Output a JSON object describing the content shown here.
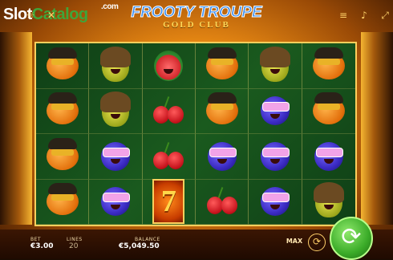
{
  "watermark": {
    "part1": "Slot",
    "part2": "Catalog",
    "suffix": ".com"
  },
  "game_title": {
    "line1": "FROOTY TROUPE",
    "line2": "GOLD CLUB"
  },
  "top_icons": {
    "left": [
      "bulb-icon",
      "close-icon"
    ],
    "right": [
      "menu-icon",
      "sound-icon",
      "fullscreen-icon"
    ]
  },
  "reels": [
    [
      "orange",
      "pear",
      "watermelon",
      "orange",
      "pear",
      "orange"
    ],
    [
      "orange",
      "pear",
      "cherry",
      "orange",
      "plum",
      "orange"
    ],
    [
      "orange",
      "plum",
      "cherry",
      "plum",
      "plum",
      "plum"
    ],
    [
      "orange",
      "plum",
      "seven",
      "cherry",
      "plum",
      "pear"
    ]
  ],
  "seven_glyph": "7",
  "footer": {
    "bet_label": "BET",
    "bet_value": "€3.00",
    "lines_label": "LINES",
    "lines_value": "20",
    "balance_label": "BALANCE",
    "balance_value": "€5,049.50",
    "max_label": "MAX",
    "autoplay_glyph": "⟳",
    "spin_glyph": "⟳"
  },
  "colors": {
    "accent_gold": "#ffcf5c",
    "reel_green": "#1a5a1e",
    "spin_green": "#3aab28",
    "title_blue": "#3b8ef0"
  }
}
